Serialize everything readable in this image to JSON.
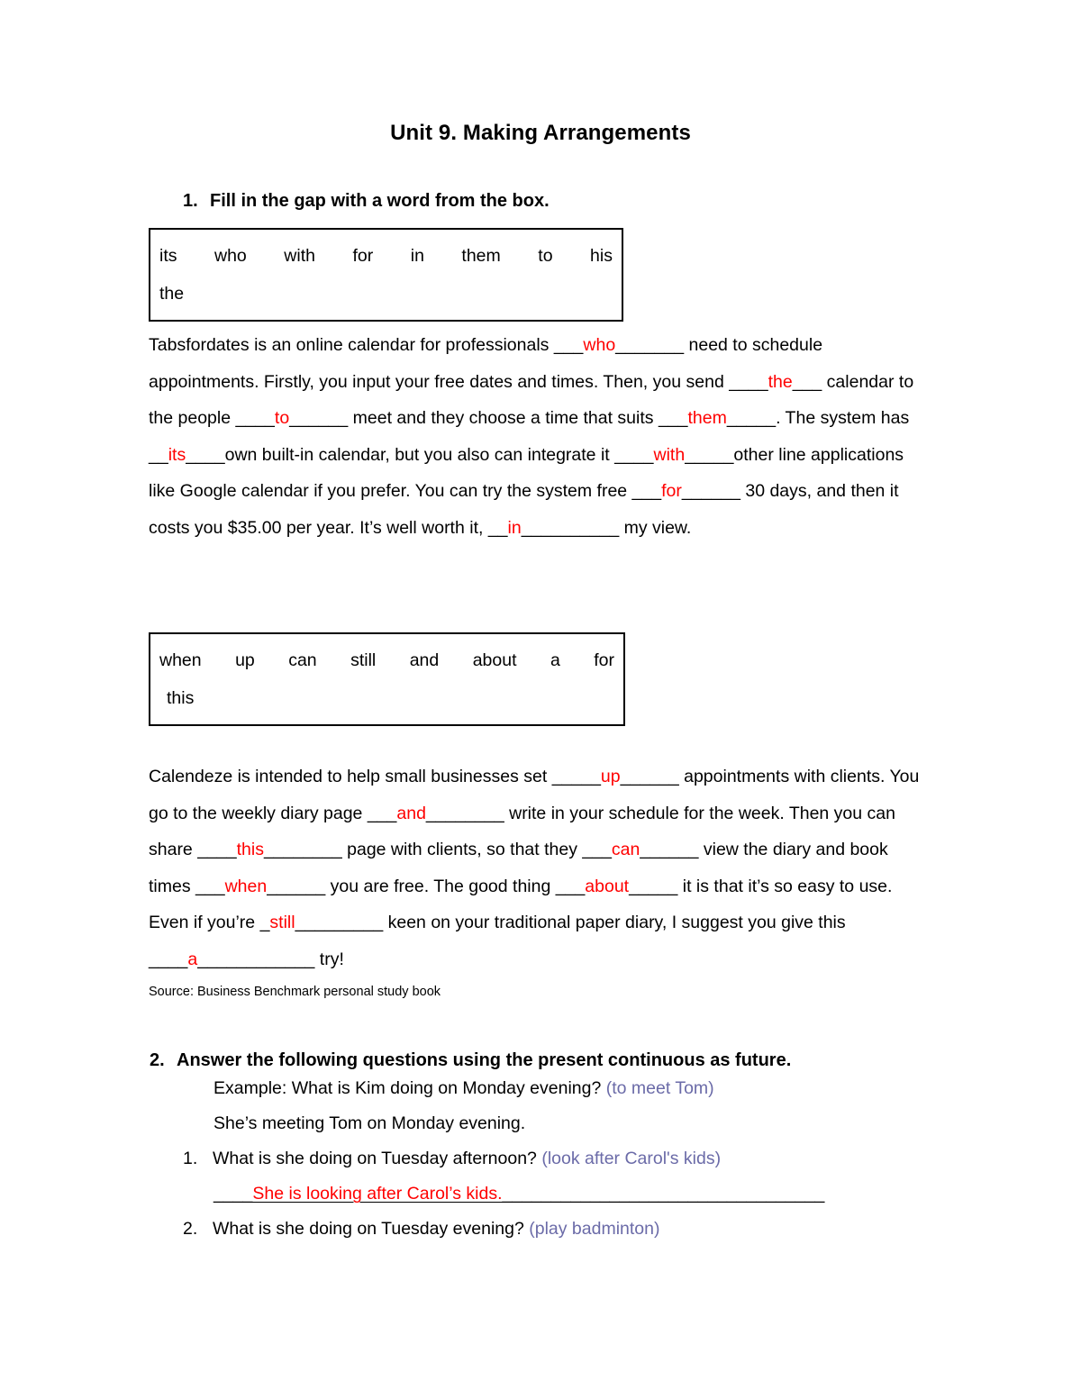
{
  "document": {
    "title": "Unit 9. Making Arrangements"
  },
  "colors": {
    "answer_red": "#ff0000",
    "hint_blue": "#6b6ba8",
    "text_black": "#000000",
    "box_border": "#000000"
  },
  "exercise1": {
    "number": "1.",
    "heading": "Fill in the gap with a word from the box.",
    "wordbox1": {
      "row1": [
        "its",
        "who",
        "with",
        "for",
        "in",
        "them",
        "to",
        "his"
      ],
      "row2": [
        "the"
      ]
    },
    "paragraph1": {
      "segments": [
        {
          "type": "text",
          "value": "Tabsfordates is an online calendar for professionals "
        },
        {
          "type": "blank_pre",
          "value": "___"
        },
        {
          "type": "answer",
          "value": "who"
        },
        {
          "type": "blank_post",
          "value": "_______"
        },
        {
          "type": "text",
          "value": " need to schedule appointments. Firstly, you input your free dates and times. Then, you send "
        },
        {
          "type": "blank_pre",
          "value": "____"
        },
        {
          "type": "answer",
          "value": "the"
        },
        {
          "type": "blank_post",
          "value": "___"
        },
        {
          "type": "text",
          "value": " calendar to the people "
        },
        {
          "type": "blank_pre",
          "value": "____"
        },
        {
          "type": "answer",
          "value": "to"
        },
        {
          "type": "blank_post",
          "value": "______"
        },
        {
          "type": "text",
          "value": " meet and they choose a time that suits "
        },
        {
          "type": "blank_pre",
          "value": "___"
        },
        {
          "type": "answer",
          "value": "them"
        },
        {
          "type": "blank_post",
          "value": "_____"
        },
        {
          "type": "text",
          "value": ". The system has "
        },
        {
          "type": "blank_pre",
          "value": "__"
        },
        {
          "type": "answer",
          "value": "its"
        },
        {
          "type": "blank_post",
          "value": "____"
        },
        {
          "type": "text",
          "value": "own built-in calendar, but you also can integrate it "
        },
        {
          "type": "blank_pre",
          "value": "____"
        },
        {
          "type": "answer",
          "value": "with"
        },
        {
          "type": "blank_post",
          "value": "_____"
        },
        {
          "type": "text",
          "value": "other line applications like Google calendar if you prefer. You can try the system free "
        },
        {
          "type": "blank_pre",
          "value": "___"
        },
        {
          "type": "answer",
          "value": "for"
        },
        {
          "type": "blank_post",
          "value": "______"
        },
        {
          "type": "text",
          "value": " 30 days, and then it costs you $35.00 per year. It’s well worth it, "
        },
        {
          "type": "blank_pre",
          "value": "__"
        },
        {
          "type": "answer",
          "value": "in"
        },
        {
          "type": "blank_post",
          "value": "__________"
        },
        {
          "type": "text",
          "value": " my view."
        }
      ]
    },
    "wordbox2": {
      "row1": [
        "when",
        "up",
        "can",
        "still",
        "and",
        "about",
        "a",
        "for"
      ],
      "row2": [
        "this"
      ]
    },
    "paragraph2": {
      "segments": [
        {
          "type": "text",
          "value": "Calendeze is intended to help small businesses set "
        },
        {
          "type": "blank_pre",
          "value": "_____"
        },
        {
          "type": "answer",
          "value": "up"
        },
        {
          "type": "blank_post",
          "value": "______"
        },
        {
          "type": "text",
          "value": " appointments with clients. You go to the weekly diary page "
        },
        {
          "type": "blank_pre",
          "value": "___"
        },
        {
          "type": "answer",
          "value": "and"
        },
        {
          "type": "blank_post",
          "value": "________"
        },
        {
          "type": "text",
          "value": " write in your schedule for the week. Then you can share "
        },
        {
          "type": "blank_pre",
          "value": "____"
        },
        {
          "type": "answer",
          "value": "this"
        },
        {
          "type": "blank_post",
          "value": "________"
        },
        {
          "type": "text",
          "value": " page with clients, so that they "
        },
        {
          "type": "blank_pre",
          "value": "___"
        },
        {
          "type": "answer",
          "value": "can"
        },
        {
          "type": "blank_post",
          "value": "______"
        },
        {
          "type": "text",
          "value": " view the diary and book times "
        },
        {
          "type": "blank_pre",
          "value": "___"
        },
        {
          "type": "answer",
          "value": "when"
        },
        {
          "type": "blank_post",
          "value": "______"
        },
        {
          "type": "text",
          "value": " you are free. The good thing "
        },
        {
          "type": "blank_pre",
          "value": "___"
        },
        {
          "type": "answer",
          "value": "about"
        },
        {
          "type": "blank_post",
          "value": "_____"
        },
        {
          "type": "text",
          "value": " it is that it’s so easy to use. Even if you’re "
        },
        {
          "type": "blank_pre",
          "value": "_"
        },
        {
          "type": "answer",
          "value": "still"
        },
        {
          "type": "blank_post",
          "value": "_________"
        },
        {
          "type": "text",
          "value": " keen on your traditional paper diary, I suggest you give this "
        },
        {
          "type": "blank_pre",
          "value": "____"
        },
        {
          "type": "answer",
          "value": "a"
        },
        {
          "type": "blank_post",
          "value": "____________"
        },
        {
          "type": "text",
          "value": " try!"
        }
      ]
    },
    "source": "Source: Business Benchmark personal study book"
  },
  "exercise2": {
    "number": "2.",
    "heading": "Answer the following questions using the present continuous as future.",
    "example": {
      "question_label": "Example: What is Kim doing on Monday evening?",
      "hint": "(to meet Tom)",
      "answer": "She’s meeting Tom on Monday evening."
    },
    "questions": [
      {
        "number": "1.",
        "text": "What is she doing on Tuesday afternoon?",
        "hint": "(look after Carol's kids)",
        "answer": {
          "lead": "____",
          "value": "She is looking after Carol’s kids.",
          "tail": "_________________________________"
        }
      },
      {
        "number": "2.",
        "text": "What is she doing on Tuesday evening?",
        "hint": "(play badminton)",
        "answer": null
      }
    ]
  }
}
